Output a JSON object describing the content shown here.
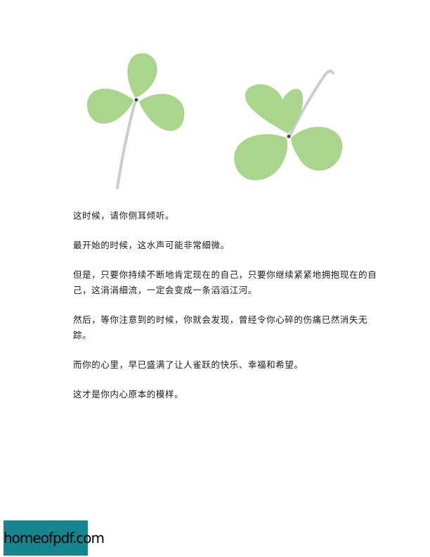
{
  "illustration": {
    "icon": "clover-leaves-illustration",
    "leaf_color": "#a8d48a",
    "stem_color": "#c8c8c8"
  },
  "paragraphs": [
    "这时候，请你侧耳倾听。",
    "最开始的时候，这水声可能非常细微。",
    "但是，只要你持续不断地肯定现在的自己，只要你继续紧紧地拥抱现在的自己，这涓涓细流，一定会变成一条滔滔江河。",
    "然后，等你注意到的时候，你就会发现，曾经令你心碎的伤痛已然消失无踪。",
    "而你的心里，早已盛满了让人雀跃的快乐、幸福和希望。",
    "这才是你内心原本的模样。"
  ],
  "watermark": {
    "text": "homeofpdf.com",
    "color": "#16858e"
  }
}
